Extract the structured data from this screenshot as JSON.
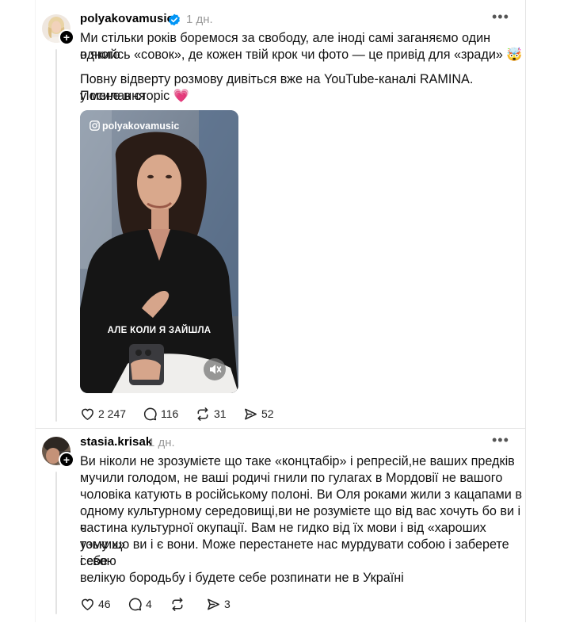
{
  "posts": [
    {
      "username": "polyakovamusic",
      "verified": true,
      "time": "1 дн.",
      "paragraphs": [
        [
          "Ми стільки років боремося за свободу, але іноді самі заганяємо один одного",
          "в якийсь «совок», де кожен твій крок чи фото — це привід для «зради» 🤯"
        ],
        [
          "Повну відверту розмову дивіться вже на YouTube-каналі RAMINA. Посилання",
          "у мене в сторіс 💗"
        ]
      ],
      "media": {
        "handle": "polyakovamusic",
        "caption": "АЛЕ КОЛИ Я ЗАЙШЛА",
        "icon": "instagram-icon",
        "mute_icon": "muted-speaker-icon"
      },
      "actions": {
        "likes": "2 247",
        "comments": "116",
        "reposts": "31",
        "shares": "52"
      }
    },
    {
      "username": "stasia.krisak",
      "verified": false,
      "time": "1 дн.",
      "lines": [
        "Ви ніколи не зрозумієте що таке «концтабір» і репресій,не ваших предків",
        "мучили голодом, не ваші родичі гнили по гулагах в Мордовії не вашого",
        "чоловіка катують в російському полоні. Ви Оля роками жили з кацапами в",
        "одному культурному середовищі,ви не розумієте що від вас хочуть бо ви і є",
        "частина культурної окупації. Вам не гидко від їх мови і від «хароших узьких»",
        "тому що ви і є вони. Може перестанете нас мурдувати собою і заберете себе",
        "і свою",
        "велікую бородьбу і будете себе розпинати не в Україні"
      ],
      "actions": {
        "likes": "46",
        "comments": "4",
        "reposts": "",
        "shares": "3"
      }
    }
  ],
  "icons": {
    "like": "heart-icon",
    "comment": "comment-bubble-icon",
    "repost": "repost-arrows-icon",
    "share": "send-icon",
    "more": "more-dots-icon",
    "follow": "plus-icon",
    "verified": "verified-badge-icon"
  },
  "colors": {
    "verified": "#0095f6",
    "muted_text": "#9a9a9a",
    "thread_line": "#e3e3e3"
  }
}
